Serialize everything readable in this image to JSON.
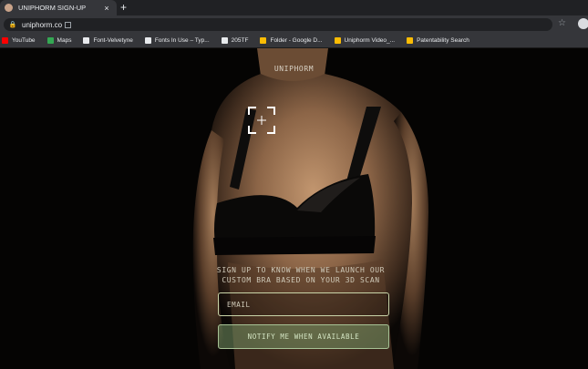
{
  "browser": {
    "tab": {
      "title": "UNIPHORM SIGN-UP",
      "close_glyph": "×"
    },
    "new_tab_glyph": "+",
    "url": "uniphorm.co",
    "bookmarks": [
      {
        "label": "YouTube",
        "icon": "youtube-icon",
        "color": "#ff0000"
      },
      {
        "label": "Maps",
        "icon": "maps-icon",
        "color": "#34a853"
      },
      {
        "label": "Font-Velvetyne",
        "icon": "velvetyne-icon",
        "color": "#e8eaed"
      },
      {
        "label": "Fonts In Use – Typ...",
        "icon": "fontsinuse-icon",
        "color": "#e8eaed"
      },
      {
        "label": "205TF",
        "icon": "205tf-icon",
        "color": "#e8eaed"
      },
      {
        "label": "Folder - Google D...",
        "icon": "google-drive-icon",
        "color": "#fbbc04"
      },
      {
        "label": "Uniphorm Video_...",
        "icon": "google-drive-icon",
        "color": "#fbbc04"
      },
      {
        "label": "Patentability Search",
        "icon": "google-drive-icon",
        "color": "#fbbc04"
      }
    ]
  },
  "page": {
    "brand": "UNIPHORM",
    "tagline_line1": "SIGN UP TO KNOW WHEN WE LAUNCH OUR",
    "tagline_line2": "CUSTOM BRA BASED ON YOUR 3D SCAN",
    "email_placeholder": "EMAIL",
    "notify_label": "NOTIFY ME WHEN AVAILABLE",
    "accent_color": "#a7c295"
  }
}
